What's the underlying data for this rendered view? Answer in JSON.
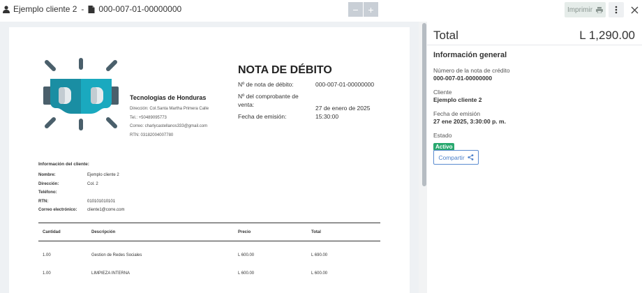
{
  "header": {
    "client_name": "Ejemplo cliente 2",
    "separator": "-",
    "document_number": "000-007-01-00000000",
    "zoom_out_label": "−",
    "zoom_in_label": "+",
    "print_label": "Imprimir",
    "icons": {
      "user": "user-icon",
      "file": "file-icon",
      "print": "printer-icon",
      "more": "more-vertical-icon",
      "close": "close-icon"
    }
  },
  "document": {
    "company": {
      "name": "Tecnologías de Honduras",
      "address": "Dirección: Col.Santa Martha Primera Calle",
      "phone": "Tel.: +50489095773",
      "email": "Correo: charlycastellanos333@gmail.com",
      "rtn": "RTN: 03182004007780"
    },
    "title": "NOTA DE DÉBITO",
    "fields": [
      {
        "label": "Nº de nota de débito:",
        "value": "000-007-01-00000000"
      },
      {
        "label": "Nº del comprobante de venta:",
        "value": "27 de enero de 2025"
      },
      {
        "label": "Fecha de emisión:",
        "value": "15:30:00"
      }
    ],
    "client_info": {
      "heading": "Información del cliente:",
      "rows": [
        {
          "label": "Nombre:",
          "value": "Ejemplo cliente 2"
        },
        {
          "label": "Dirección:",
          "value": "Col. 2"
        },
        {
          "label": "Teléfono:",
          "value": ""
        },
        {
          "label": "RTN:",
          "value": "010101010101"
        },
        {
          "label": "Correo electrónico:",
          "value": "cliente1@corre.com"
        }
      ]
    },
    "table": {
      "headers": [
        "Cantidad",
        "Descripción",
        "Precio",
        "Total"
      ],
      "rows": [
        [
          "1.00",
          "Gestion de Redes Sociales",
          "L 600.00",
          "L 690.00"
        ],
        [
          "1.00",
          "LIMPIEZA INTERNA",
          "L 600.00",
          "L 600.00"
        ]
      ]
    }
  },
  "panel": {
    "total_label": "Total",
    "total_value": "L 1,290.00",
    "section_title": "Información general",
    "fields": [
      {
        "label": "Número de la nota de crédito",
        "value": "000-007-01-00000000"
      },
      {
        "label": "Cliente",
        "value": "Ejemplo cliente 2"
      },
      {
        "label": "Fecha de emisión",
        "value": "27 ene 2025, 3:30:00 p. m."
      }
    ],
    "status_label": "Estado",
    "status_value": "Activo",
    "status_color": "#28a86e",
    "share_label": "Compartir",
    "share_icon": "share-icon"
  },
  "colors": {
    "logo_body": "#1aa9bf",
    "logo_dark": "#4a5f6b",
    "accent_blue": "#4a7fc9"
  }
}
